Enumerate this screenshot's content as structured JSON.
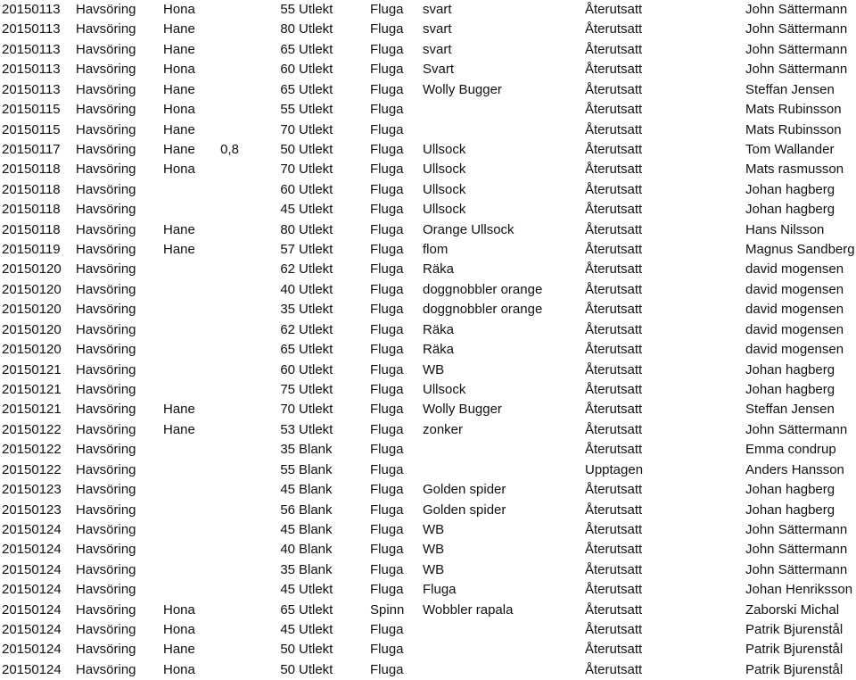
{
  "rows": [
    [
      "20150113",
      "Havsöring",
      "Hona",
      "",
      "55",
      "Utlekt",
      "Fluga",
      "svart",
      "Återutsatt",
      "John Sättermann"
    ],
    [
      "20150113",
      "Havsöring",
      "Hane",
      "",
      "80",
      "Utlekt",
      "Fluga",
      "svart",
      "Återutsatt",
      "John Sättermann"
    ],
    [
      "20150113",
      "Havsöring",
      "Hane",
      "",
      "65",
      "Utlekt",
      "Fluga",
      "svart",
      "Återutsatt",
      "John Sättermann"
    ],
    [
      "20150113",
      "Havsöring",
      "Hona",
      "",
      "60",
      "Utlekt",
      "Fluga",
      "Svart",
      "Återutsatt",
      "John Sättermann"
    ],
    [
      "20150113",
      "Havsöring",
      "Hane",
      "",
      "65",
      "Utlekt",
      "Fluga",
      "Wolly Bugger",
      "Återutsatt",
      "Steffan Jensen"
    ],
    [
      "20150115",
      "Havsöring",
      "Hona",
      "",
      "55",
      "Utlekt",
      "Fluga",
      "",
      "Återutsatt",
      "Mats Rubinsson"
    ],
    [
      "20150115",
      "Havsöring",
      "Hane",
      "",
      "70",
      "Utlekt",
      "Fluga",
      "",
      "Återutsatt",
      "Mats Rubinsson"
    ],
    [
      "20150117",
      "Havsöring",
      "Hane",
      "0,8",
      "50",
      "Utlekt",
      "Fluga",
      "Ullsock",
      "Återutsatt",
      "Tom Wallander"
    ],
    [
      "20150118",
      "Havsöring",
      "Hona",
      "",
      "70",
      "Utlekt",
      "Fluga",
      "Ullsock",
      "Återutsatt",
      "Mats rasmusson"
    ],
    [
      "20150118",
      "Havsöring",
      "",
      "",
      "60",
      "Utlekt",
      "Fluga",
      "Ullsock",
      "Återutsatt",
      "Johan hagberg"
    ],
    [
      "20150118",
      "Havsöring",
      "",
      "",
      "45",
      "Utlekt",
      "Fluga",
      "Ullsock",
      "Återutsatt",
      "Johan hagberg"
    ],
    [
      "20150118",
      "Havsöring",
      "Hane",
      "",
      "80",
      "Utlekt",
      "Fluga",
      "Orange Ullsock",
      "Återutsatt",
      "Hans Nilsson"
    ],
    [
      "20150119",
      "Havsöring",
      "Hane",
      "",
      "57",
      "Utlekt",
      "Fluga",
      "flom",
      "Återutsatt",
      "Magnus Sandberg"
    ],
    [
      "20150120",
      "Havsöring",
      "",
      "",
      "62",
      "Utlekt",
      "Fluga",
      "Räka",
      "Återutsatt",
      "david mogensen"
    ],
    [
      "20150120",
      "Havsöring",
      "",
      "",
      "40",
      "Utlekt",
      "Fluga",
      "doggnobbler orange",
      "Återutsatt",
      "david mogensen"
    ],
    [
      "20150120",
      "Havsöring",
      "",
      "",
      "35",
      "Utlekt",
      "Fluga",
      "doggnobbler orange",
      "Återutsatt",
      "david mogensen"
    ],
    [
      "20150120",
      "Havsöring",
      "",
      "",
      "62",
      "Utlekt",
      "Fluga",
      "Räka",
      "Återutsatt",
      "david mogensen"
    ],
    [
      "20150120",
      "Havsöring",
      "",
      "",
      "65",
      "Utlekt",
      "Fluga",
      "Räka",
      "Återutsatt",
      "david mogensen"
    ],
    [
      "20150121",
      "Havsöring",
      "",
      "",
      "60",
      "Utlekt",
      "Fluga",
      "WB",
      "Återutsatt",
      "Johan hagberg"
    ],
    [
      "20150121",
      "Havsöring",
      "",
      "",
      "75",
      "Utlekt",
      "Fluga",
      "Ullsock",
      "Återutsatt",
      "Johan hagberg"
    ],
    [
      "20150121",
      "Havsöring",
      "Hane",
      "",
      "70",
      "Utlekt",
      "Fluga",
      "Wolly Bugger",
      "Återutsatt",
      "Steffan Jensen"
    ],
    [
      "20150122",
      "Havsöring",
      "Hane",
      "",
      "53",
      "Utlekt",
      "Fluga",
      "zonker",
      "Återutsatt",
      "John Sättermann"
    ],
    [
      "20150122",
      "Havsöring",
      "",
      "",
      "35",
      "Blank",
      "Fluga",
      "",
      "Återutsatt",
      "Emma condrup"
    ],
    [
      "20150122",
      "Havsöring",
      "",
      "",
      "55",
      "Blank",
      "Fluga",
      "",
      "Upptagen",
      "Anders Hansson"
    ],
    [
      "20150123",
      "Havsöring",
      "",
      "",
      "45",
      "Blank",
      "Fluga",
      "Golden spider",
      "Återutsatt",
      "Johan hagberg"
    ],
    [
      "20150123",
      "Havsöring",
      "",
      "",
      "56",
      "Blank",
      "Fluga",
      "Golden spider",
      "Återutsatt",
      "Johan hagberg"
    ],
    [
      "20150124",
      "Havsöring",
      "",
      "",
      "45",
      "Blank",
      "Fluga",
      "WB",
      "Återutsatt",
      "John Sättermann"
    ],
    [
      "20150124",
      "Havsöring",
      "",
      "",
      "40",
      "Blank",
      "Fluga",
      "WB",
      "Återutsatt",
      "John Sättermann"
    ],
    [
      "20150124",
      "Havsöring",
      "",
      "",
      "35",
      "Blank",
      "Fluga",
      "WB",
      "Återutsatt",
      "John Sättermann"
    ],
    [
      "20150124",
      "Havsöring",
      "",
      "",
      "45",
      "Utlekt",
      "Fluga",
      "Fluga",
      "Återutsatt",
      "Johan Henriksson"
    ],
    [
      "20150124",
      "Havsöring",
      "Hona",
      "",
      "65",
      "Utlekt",
      "Spinn",
      "Wobbler rapala",
      "Återutsatt",
      "Zaborski Michal"
    ],
    [
      "20150124",
      "Havsöring",
      "Hona",
      "",
      "45",
      "Utlekt",
      "Fluga",
      "",
      "Återutsatt",
      "Patrik Bjurenstål"
    ],
    [
      "20150124",
      "Havsöring",
      "Hane",
      "",
      "50",
      "Utlekt",
      "Fluga",
      "",
      "Återutsatt",
      "Patrik Bjurenstål"
    ],
    [
      "20150124",
      "Havsöring",
      "Hona",
      "",
      "50",
      "Utlekt",
      "Fluga",
      "",
      "Återutsatt",
      "Patrik Bjurenstål"
    ]
  ]
}
